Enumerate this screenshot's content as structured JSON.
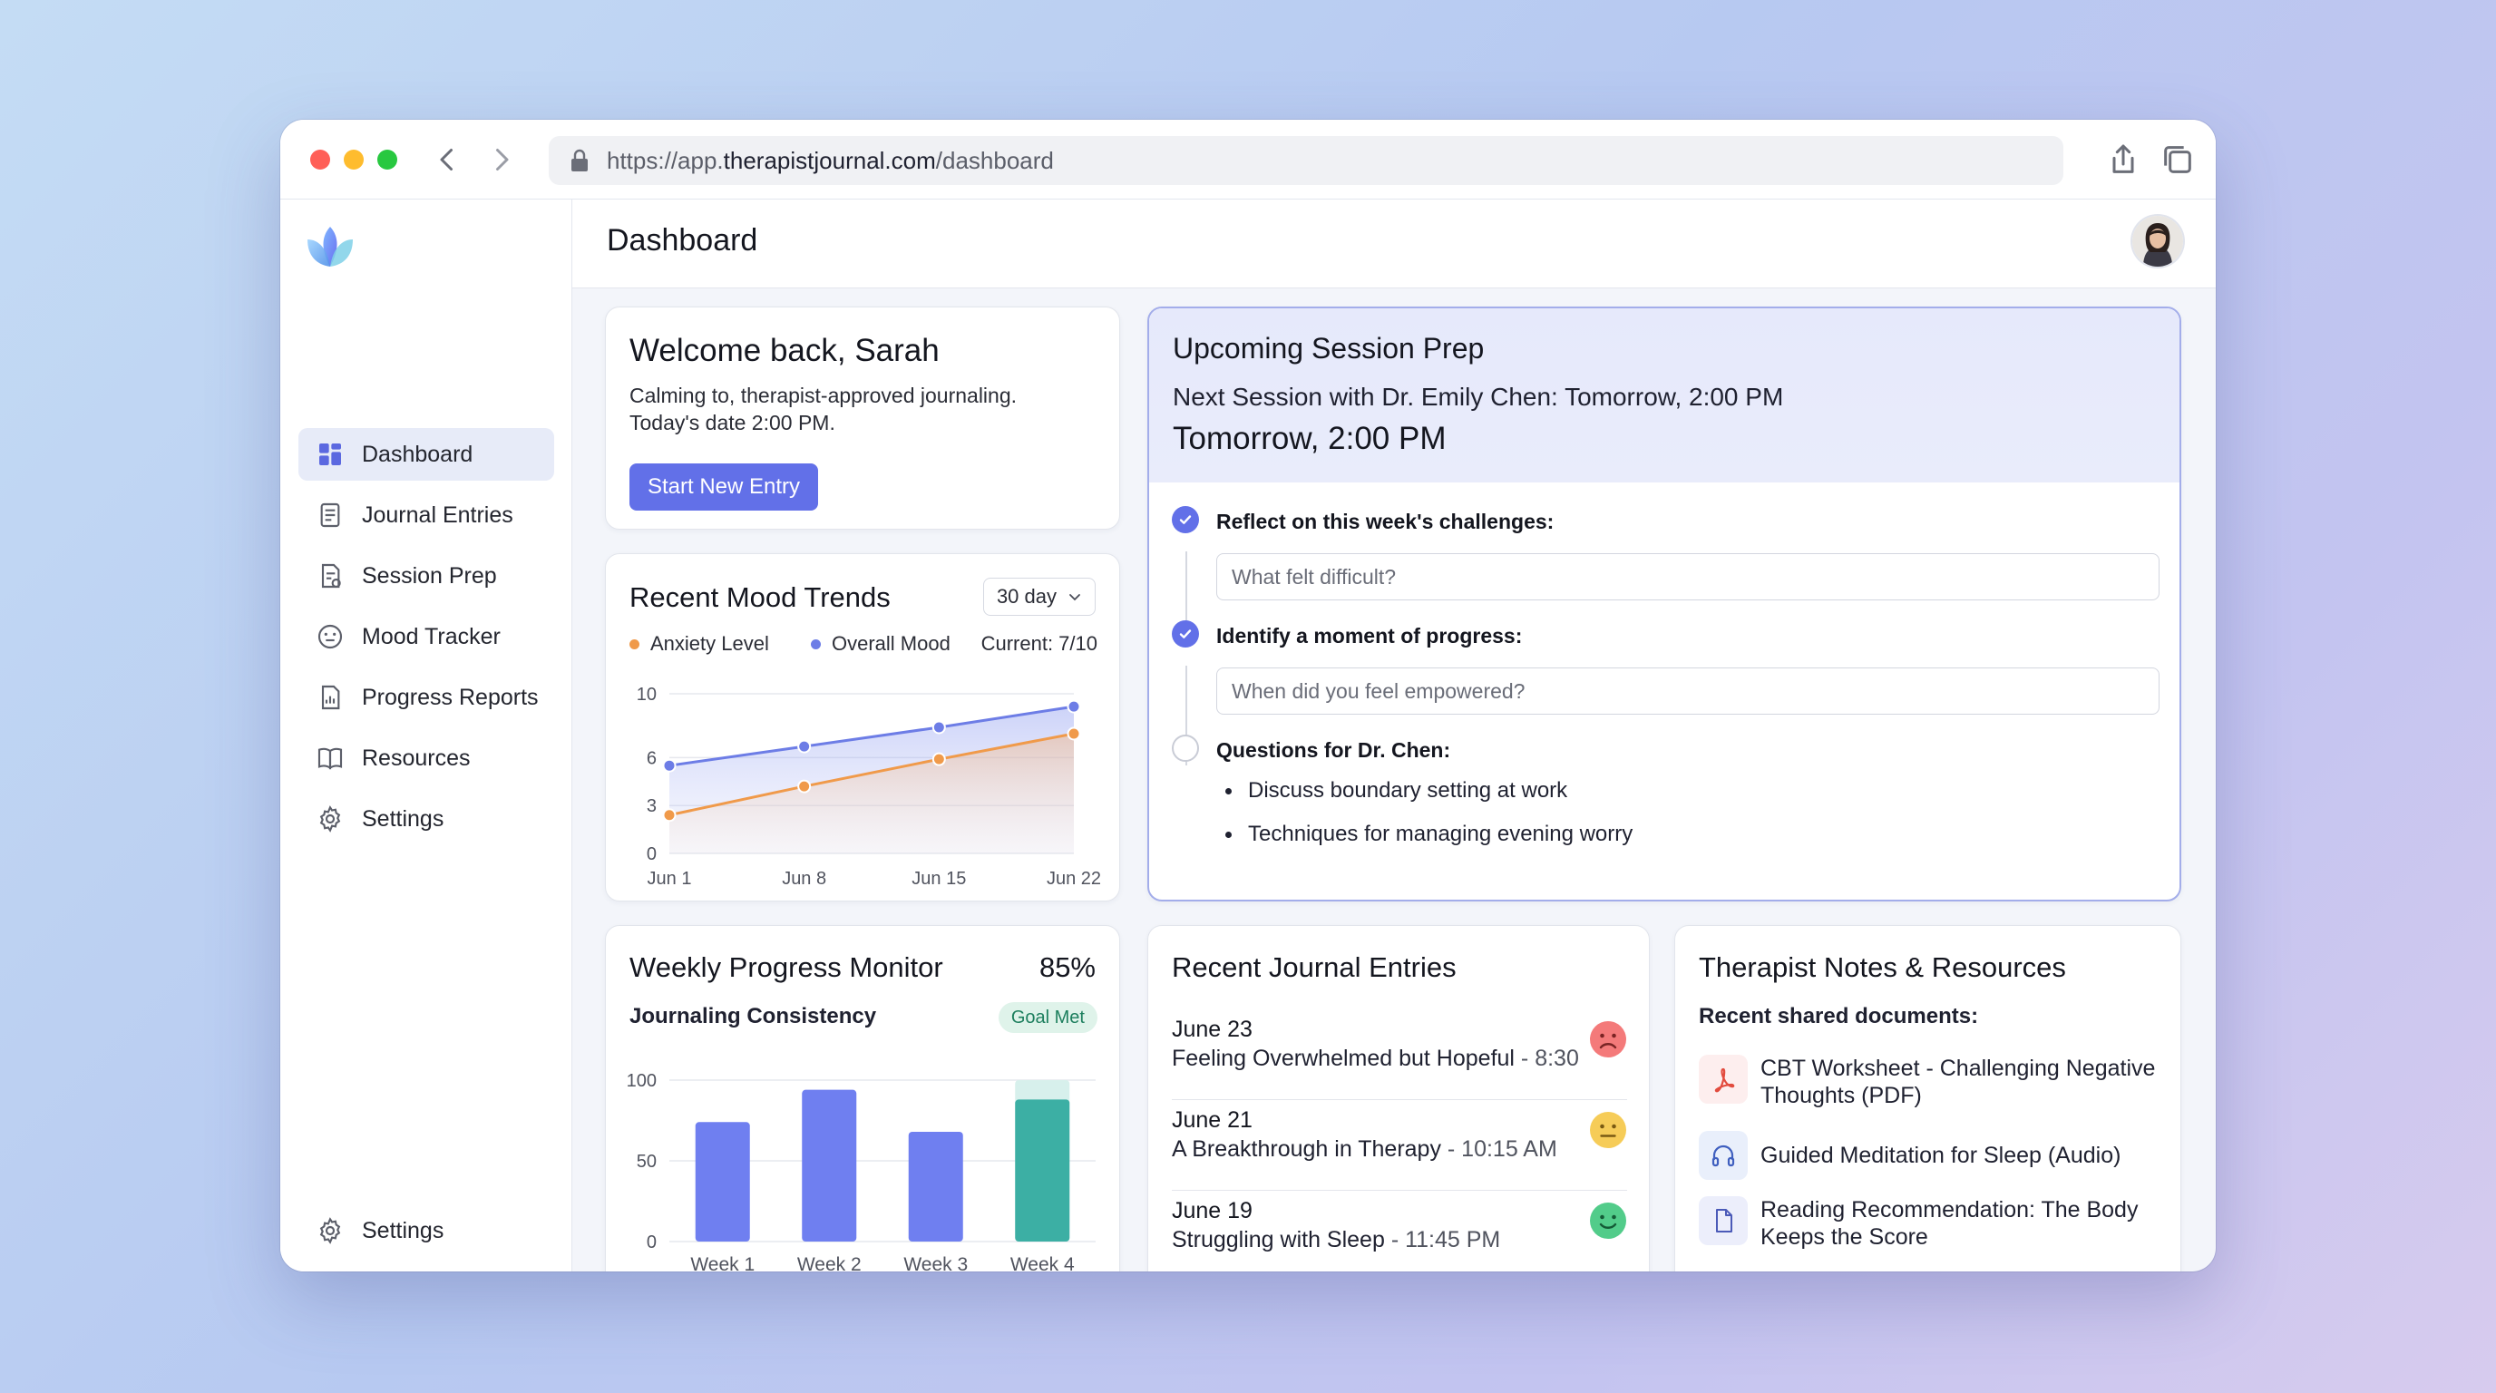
{
  "browser": {
    "url_prefix": "https://app.",
    "url_host": "therapistjournal.com",
    "url_path": "/dashboard"
  },
  "sidebar": {
    "items": [
      {
        "label": "Dashboard",
        "icon": "dashboard-icon",
        "active": true
      },
      {
        "label": "Journal Entries",
        "icon": "journal-icon"
      },
      {
        "label": "Session Prep",
        "icon": "session-prep-icon"
      },
      {
        "label": "Mood Tracker",
        "icon": "mood-icon"
      },
      {
        "label": "Progress Reports",
        "icon": "report-icon"
      },
      {
        "label": "Resources",
        "icon": "book-icon"
      },
      {
        "label": "Settings",
        "icon": "gear-icon"
      }
    ],
    "bottom_settings": "Settings"
  },
  "header": {
    "title": "Dashboard"
  },
  "welcome": {
    "title": "Welcome back, Sarah",
    "line1": "Calming to, therapist-approved journaling.",
    "line2": "Today's date 2:00 PM.",
    "button": "Start New Entry"
  },
  "mood": {
    "title": "Recent Mood Trends",
    "range": "30 day",
    "legend_anxiety": "Anxiety Level",
    "legend_overall": "Overall Mood",
    "current": "Current: 7/10"
  },
  "session": {
    "title": "Upcoming Session Prep",
    "next": "Next Session with Dr. Emily Chen: Tomorrow, 2:00 PM",
    "time": "Tomorrow, 2:00 PM",
    "q1_label": "Reflect on this week's challenges:",
    "q1_placeholder": "What felt difficult?",
    "q2_label": "Identify a moment of progress:",
    "q2_placeholder": "When did you feel empowered?",
    "q3_label": "Questions for Dr. Chen:",
    "bullets": [
      "Discuss boundary setting at work",
      "Techniques for managing evening worry"
    ]
  },
  "weekly": {
    "title": "Weekly Progress Monitor",
    "percent": "85%",
    "sublabel": "Journaling Consistency",
    "badge": "Goal Met"
  },
  "journal": {
    "title": "Recent Journal Entries",
    "entries": [
      {
        "date": "June 23",
        "text": "Feeling Overwhelmed but Hopeful",
        "time": " - 8:30",
        "mood": "sad"
      },
      {
        "date": "June 21",
        "text": "A Breakthrough in Therapy",
        "time": " - 10:15 AM",
        "mood": "neutral"
      },
      {
        "date": "June 19",
        "text": "Struggling with Sleep",
        "time": " - 11:45 PM",
        "mood": "happy"
      }
    ]
  },
  "notes": {
    "title": "Therapist Notes & Resources",
    "docs_label": "Recent shared documents:",
    "docs": [
      {
        "text": "CBT Worksheet - Challenging Negative Thoughts (PDF)",
        "icon": "pdf-icon"
      },
      {
        "text": "Guided Meditation for Sleep (Audio)",
        "icon": "headphones-icon"
      },
      {
        "text": "Reading Recommendation: The Body Keeps the Score",
        "icon": "document-icon"
      }
    ]
  },
  "chart_data": [
    {
      "type": "line",
      "x": [
        "Jun 1",
        "Jun 8",
        "Jun 15",
        "Jun 22"
      ],
      "series": [
        {
          "name": "Anxiety Level",
          "values": [
            2.4,
            4.2,
            5.9,
            7.5
          ],
          "color": "#f09a4a"
        },
        {
          "name": "Overall Mood",
          "values": [
            5.5,
            6.7,
            7.9,
            9.2
          ],
          "color": "#6d7de6"
        }
      ],
      "yticks": [
        0,
        3,
        6,
        10
      ],
      "ylim": [
        0,
        10
      ]
    },
    {
      "type": "bar",
      "categories": [
        "Week 1",
        "Week 2",
        "Week 3",
        "Week 4"
      ],
      "values": [
        74,
        94,
        68,
        88
      ],
      "colors": [
        "#6f7ff0",
        "#6f7ff0",
        "#6f7ff0",
        "#3cafa4"
      ],
      "yticks": [
        0,
        50,
        100
      ],
      "ylim": [
        0,
        100
      ]
    }
  ]
}
